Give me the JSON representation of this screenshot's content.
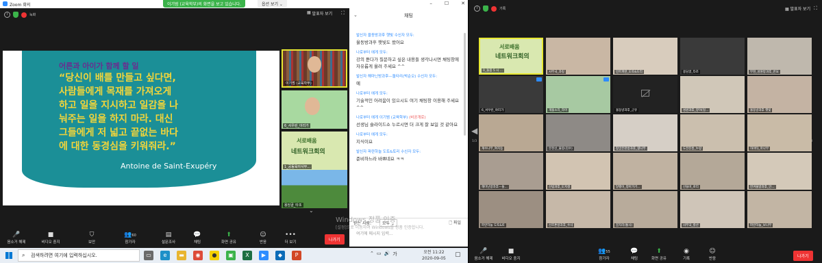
{
  "left": {
    "app_title": "Zoom 회의",
    "share_banner": "이기범 (교육학부)의 화면을 보고 있습니다.",
    "stop_share": "옵션 보기 ⌄",
    "recording_label": "녹화",
    "speaker_view": "발표자 보기",
    "slide": {
      "heading": "어른과 아이가 함께 할 일",
      "quote_lines": [
        "“당신이 배를 만들고 싶다면,",
        "사람들에게 목재를 가져오게",
        "하고 일을 지시하고 일감을 나",
        "눠주는 일을 하지 마라. 대신",
        "그들에게 저 넓고 끝없는 바다",
        "에 대한 동경심을 키워줘라.”"
      ],
      "author": "Antoine de Saint-Exupéry"
    },
    "videos": [
      {
        "name": "이기범 (교육학부)"
      },
      {
        "name": "6_서우린_야리가"
      },
      {
        "name": "1_공동육아사무..."
      },
      {
        "name": "용담골_타조"
      }
    ],
    "video_slide_text1": "서로배움",
    "video_slide_text2": "네트워크회의",
    "chat": {
      "title": "채팅",
      "messages": [
        {
          "from": "발신자 울동방과후 햇빛 수신자 모두:",
          "text": "울동방과후 햇빛도 왔어요",
          "private": ""
        },
        {
          "from": "나로부터 에게 모두:",
          "text": "강의 듣다가 질문하고 싶은 내용들 생각나시면 채팅창에 자유롭게 올려 주세요 ^^",
          "private": ""
        },
        {
          "from": "발신자 해마닌방과후—돌타리(박순오) 수신자 모두:",
          "text": "예",
          "private": ""
        },
        {
          "from": "나로부터 에게 모두:",
          "text": "기술적인 어려움이 있으시도 여기 채팅창 이용해 주세요 ^^",
          "private": ""
        },
        {
          "from": "나로부터 에게 이기범 (교육학부)",
          "text": "선생님 슬라이드쇼 누르시면 더 크게 잘 보일 것 같아요",
          "private": "(비공개로)"
        },
        {
          "from": "나로부터 에게 모두:",
          "text": "지식이요",
          "private": ""
        },
        {
          "from": "발신자 파란하늘 도토&토리 수신자 모두:",
          "text": "준비하느라 바쁘네요 ㅋㅋ",
          "private": ""
        }
      ],
      "to_label": "받는 사람:",
      "to_value": "모두 ⌄",
      "file_label": "파일",
      "placeholder": "여기에 메시지 입력..."
    },
    "watermark": "Windows 정품 인증",
    "watermark_sub": "[설정]으로 이동하여 Windows를 정품 인증합니다.",
    "toolbar": {
      "mute": "음소거 해제",
      "video": "비디오 중지",
      "security": "보안",
      "participants": "참가자",
      "participants_count": "60",
      "polls": "설문조사",
      "chat": "채팅",
      "share": "화면 공유",
      "reactions": "반응",
      "more": "더 보기",
      "end": "나가기"
    },
    "taskbar": {
      "search": "검색하려면 여기에 입력하십시오.",
      "time": "오전 11:22",
      "date": "2020-09-05",
      "ime": "가"
    }
  },
  "right": {
    "recording_label": "기록",
    "view": "발표자 보기",
    "page_left": "1/3",
    "page_right": "1/3",
    "participants": [
      {
        "name": "0_돌봄 5 시 ..."
      },
      {
        "name": "사무국_과링"
      },
      {
        "name": "민트파란_도토&도리"
      },
      {
        "name": "용담골_타조"
      },
      {
        "name": "부천_성원방과후_반요"
      },
      {
        "name": "6_서우린_야리가"
      },
      {
        "name": "개울소리_하마"
      },
      {
        "name": "울동방과후_군유"
      },
      {
        "name": "성원과후_양이(일..."
      },
      {
        "name": "울동방과후 햇빛"
      },
      {
        "name": "계수나무_여지동"
      },
      {
        "name": "분천선_물봉(김수)"
      },
      {
        "name": "창궁은천방과후_향나무"
      },
      {
        "name": "도전진흥_누량"
      },
      {
        "name": "하마타_마나무"
      },
      {
        "name": "해마닌방과후—돌..."
      },
      {
        "name": "산림과후_도지생"
      },
      {
        "name": "달팽이_청아가기..."
      },
      {
        "name": "산들바_로리"
      },
      {
        "name": "한겨울방과후_안..."
      },
      {
        "name": "파란하늘 도토&토"
      },
      {
        "name": "산즈톤방과후_수사"
      },
      {
        "name": "꿈자리(통사)"
      },
      {
        "name": "사무국_칼산"
      },
      {
        "name": "파란하늘_보나무"
      }
    ],
    "toolbar": {
      "mute": "음소거 해제",
      "video": "비디오 중지",
      "participants": "참가자",
      "participants_count": "55",
      "chat": "채팅",
      "share": "화면 공유",
      "record": "기록",
      "reactions": "반응",
      "end": "나가기"
    }
  },
  "colors": {
    "zoom_blue": "#2d8cff",
    "share_green": "#3bb34a",
    "end_red": "#e33333",
    "slide_teal": "#1b8f97",
    "slide_yellow": "#f2d53a",
    "slide_purple": "#6b2c8f"
  }
}
